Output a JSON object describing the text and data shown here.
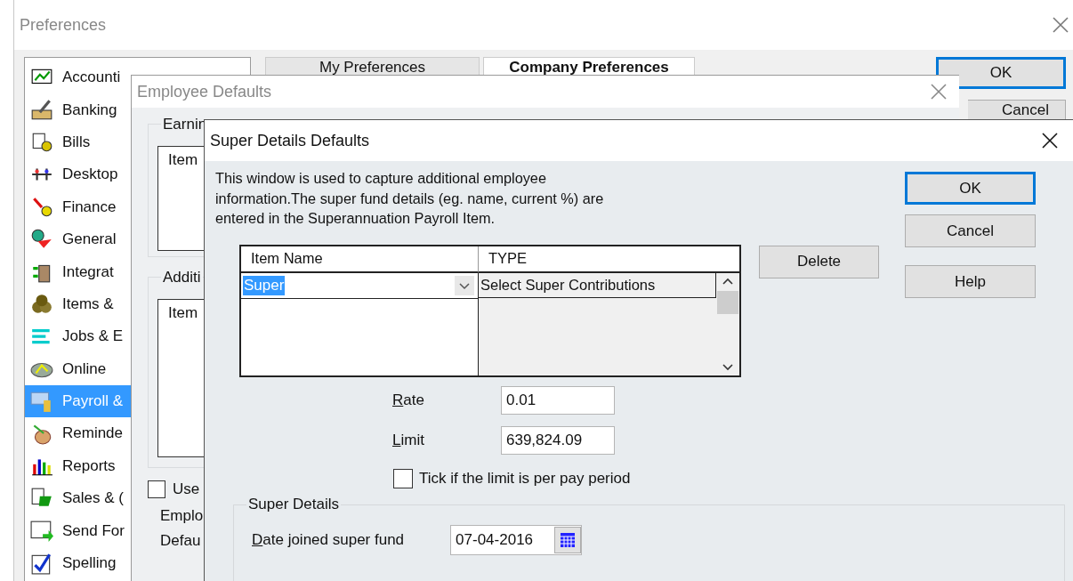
{
  "preferences": {
    "title": "Preferences",
    "sidebar": [
      {
        "label": "Accounti",
        "selected": false
      },
      {
        "label": "Banking",
        "selected": false
      },
      {
        "label": "Bills",
        "selected": false
      },
      {
        "label": "Desktop",
        "selected": false
      },
      {
        "label": "Finance",
        "selected": false
      },
      {
        "label": "General",
        "selected": false
      },
      {
        "label": "Integrat",
        "selected": false
      },
      {
        "label": "Items &",
        "selected": false
      },
      {
        "label": "Jobs & E",
        "selected": false
      },
      {
        "label": "Online",
        "selected": false
      },
      {
        "label": "Payroll &",
        "selected": true
      },
      {
        "label": "Reminde",
        "selected": false
      },
      {
        "label": "Reports",
        "selected": false
      },
      {
        "label": "Sales & (",
        "selected": false
      },
      {
        "label": "Send For",
        "selected": false
      },
      {
        "label": "Spelling",
        "selected": false
      }
    ],
    "tabs": [
      {
        "label": "My Preferences",
        "selected": false
      },
      {
        "label": "Company Preferences",
        "selected": true
      }
    ],
    "buttons": [
      {
        "label": "OK",
        "default": true
      },
      {
        "label": "Cancel",
        "default": false
      }
    ]
  },
  "employee_defaults": {
    "title": "Employee Defaults",
    "groups": [
      {
        "legend": "Earnin",
        "column": "Item"
      },
      {
        "legend": "Additi",
        "column": "Item"
      }
    ],
    "use_checkbox": {
      "label": "Use",
      "checked": false
    },
    "labels": [
      "Emplo",
      "Defau"
    ]
  },
  "super_details": {
    "title": "Super Details Defaults",
    "description": "This window is used to capture additional employee information.The super fund details (eg. name, current %) are entered in the Superannuation Payroll Item.",
    "grid": {
      "columns": [
        "Item Name",
        "TYPE"
      ],
      "rows": [
        {
          "item_name": "Super",
          "type": "Select Super Contributions",
          "selected": true
        }
      ]
    },
    "delete_button": "Delete",
    "rate": {
      "label": "Rate",
      "value": "0.01"
    },
    "limit": {
      "label": "Limit",
      "value": "639,824.09"
    },
    "per_pay_period": {
      "label": "Tick if the limit is per pay period",
      "checked": false
    },
    "group": {
      "legend": "Super Details",
      "date_label": "Date joined super fund",
      "date_value": "07-04-2016"
    },
    "buttons": [
      {
        "label": "OK",
        "default": true
      },
      {
        "label": "Cancel",
        "default": false
      },
      {
        "label": "Help",
        "default": false
      }
    ]
  }
}
